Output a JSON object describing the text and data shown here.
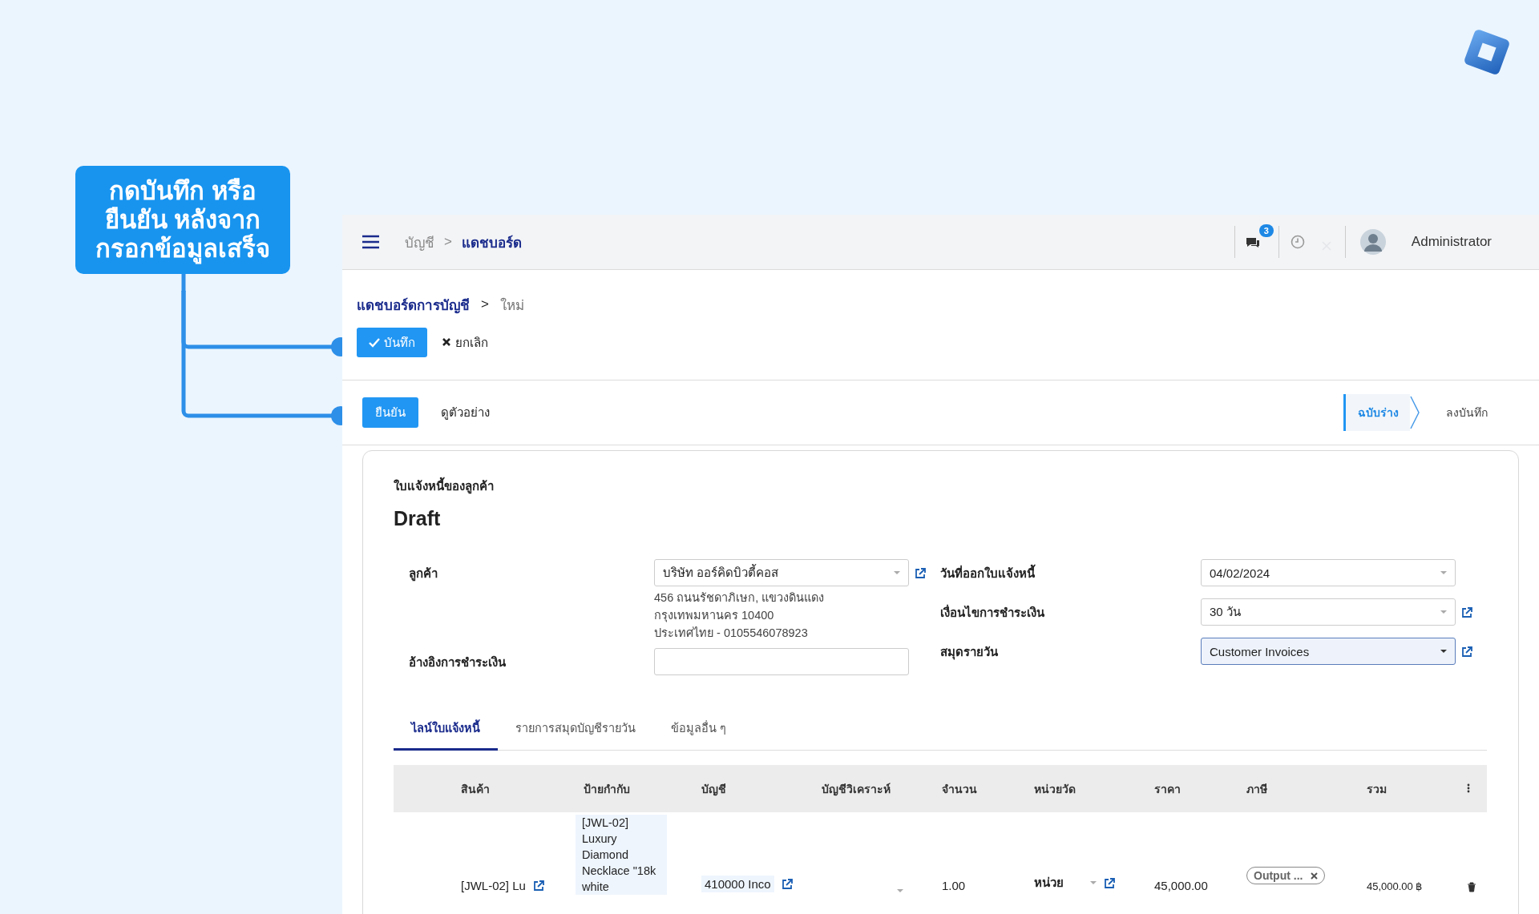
{
  "callout": {
    "lines": [
      "กดบันทึก หรือ",
      "ยืนยัน หลังจาก",
      "กรอกข้อมูลเสร็จ"
    ]
  },
  "topbar": {
    "breadcrumb": [
      {
        "label": "บัญชี",
        "current": false
      },
      {
        "label": "แดชบอร์ด",
        "current": true
      }
    ],
    "separator": ">",
    "message_count": "3",
    "user": "Administrator"
  },
  "page_breadcrumb": {
    "items": [
      {
        "label": "แดชบอร์ดการบัญชี",
        "current": false
      },
      {
        "label": "ใหม่",
        "current": true
      }
    ],
    "separator": ">"
  },
  "actions": [
    {
      "label": "บันทึก",
      "kind": "save"
    },
    {
      "label": "ยกเลิก",
      "kind": "discard"
    }
  ],
  "workflow": {
    "buttons": [
      {
        "label": "ยืนยัน",
        "kind": "primary"
      },
      {
        "label": "ดูตัวอย่าง",
        "kind": "plain"
      }
    ],
    "steps": [
      {
        "label": "ฉบับร่าง",
        "selected": true
      },
      {
        "label": "ลงบันทึก",
        "selected": false
      }
    ]
  },
  "form": {
    "heading": "ใบแจ้งหนี้ของลูกค้า",
    "title": "Draft",
    "left_fields": [
      {
        "label": "ลูกค้า",
        "value": "บริษัท ออร์คิดบิวตี้คอส",
        "dropdown": true,
        "link": true,
        "address": [
          "456 ถนนรัชดาภิเษก, แขวงดินแดง",
          "กรุงเทพมหานคร 10400",
          "ประเทศไทย - 0105546078923"
        ]
      },
      {
        "label": "อ้างอิงการชำระเงิน",
        "dropdown": false,
        "link": false
      }
    ],
    "right_fields": [
      {
        "label": "วันที่ออกใบแจ้งหนี้",
        "value": "04/02/2024",
        "dropdown": true,
        "link": false,
        "focused": false
      },
      {
        "label": "เงื่อนไขการชำระเงิน",
        "value": "30 วัน",
        "dropdown": true,
        "link": true,
        "focused": false
      },
      {
        "label": "สมุดรายวัน",
        "value": "Customer Invoices",
        "dropdown": true,
        "link": true,
        "focused": true
      }
    ]
  },
  "tabs": [
    {
      "label": "ไลน์ใบแจ้งหนี้",
      "selected": true
    },
    {
      "label": "รายการสมุดบัญชีรายวัน",
      "selected": false
    },
    {
      "label": "ข้อมูลอื่น ๆ",
      "selected": false
    }
  ],
  "table": {
    "columns": [
      "สินค้า",
      "ป้ายกำกับ",
      "บัญชี",
      "บัญชีวิเคราะห์",
      "จำนวน",
      "หน่วยวัด",
      "ราคา",
      "ภาษี",
      "รวม"
    ],
    "rows": [
      {
        "product": "[JWL-02] Lu",
        "label": "[JWL-02] Luxury Diamond Necklace \"18k white",
        "account": "410000 Inco",
        "quantity": "1.00",
        "unit": "หน่วย",
        "price": "45,000.00",
        "taxes": [
          "Output ..."
        ],
        "subtotal": "45,000.00 ฿"
      }
    ]
  }
}
